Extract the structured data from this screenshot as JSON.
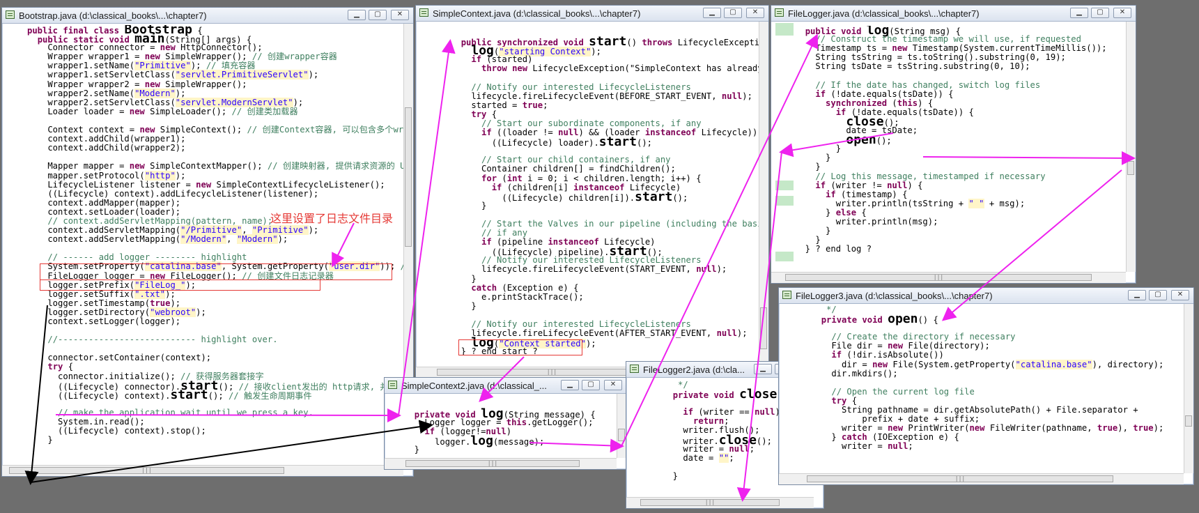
{
  "windows": {
    "bootstrap": {
      "title": "Bootstrap.java (d:\\classical_books\\...\\chapter7)",
      "lines": [
        "public final class Bootstrap {",
        "  public static void main(String[] args) {",
        "    Connector connector = new HttpConnector();",
        "    Wrapper wrapper1 = new SimpleWrapper(); // 创建wrapper容器",
        "    wrapper1.setName(\"Primitive\"); // 填充容器",
        "    wrapper1.setServletClass(\"servlet.PrimitiveServlet\");",
        "    Wrapper wrapper2 = new SimpleWrapper();",
        "    wrapper2.setName(\"Modern\");",
        "    wrapper2.setServletClass(\"servlet.ModernServlet\");",
        "    Loader loader = new SimpleLoader(); // 创建类加载器",
        "",
        "    Context context = new SimpleContext(); // 创建Context容器, 可以包含多个wrappe",
        "    context.addChild(wrapper1);",
        "    context.addChild(wrapper2);",
        "",
        "    Mapper mapper = new SimpleContextMapper(); // 创建映射器, 提供请求资源的 URI",
        "    mapper.setProtocol(\"http\");",
        "    LifecycleListener listener = new SimpleContextLifecycleListener();",
        "    ((Lifecycle) context).addLifecycleListener(listener);",
        "    context.addMapper(mapper);",
        "    context.setLoader(loader);",
        "    // context.addServletMapping(pattern, name);",
        "    context.addServletMapping(\"/Primitive\", \"Primitive\");",
        "    context.addServletMapping(\"/Modern\", \"Modern\");",
        "",
        "    // ------ add logger -------- highlight",
        "    System.setProperty(\"catalina.base\", System.getProperty(\"user.dir\")); //",
        "    FileLogger logger = new FileLogger(); // 创建文件日志记录器",
        "    logger.setPrefix(\"FileLog_\");",
        "    logger.setSuffix(\".txt\");",
        "    logger.setTimestamp(true);",
        "    logger.setDirectory(\"webroot\");",
        "    context.setLogger(logger);",
        "",
        "    //--------------------------- highlight over.",
        "",
        "    connector.setContainer(context);",
        "    try {",
        "      connector.initialize(); // 获得服务器套接字",
        "      ((Lifecycle) connector).start(); // 接收client发出的 http请求, 并做处理。",
        "      ((Lifecycle) context).start(); // 触发生命周期事件",
        "",
        "      // make the application wait until we press a key.",
        "      System.in.read();",
        "      ((Lifecycle) context).stop();",
        "    }"
      ]
    },
    "simplecontext": {
      "title": "SimpleContext.java (d:\\classical_books\\...\\chapter7)",
      "lines": [
        "",
        "  public synchronized void start() throws LifecycleException {",
        "    log(\"starting Context\");",
        "    if (started)",
        "      throw new LifecycleException(\"SimpleContext has already st",
        "",
        "    // Notify our interested LifecycleListeners",
        "    lifecycle.fireLifecycleEvent(BEFORE_START_EVENT, null);",
        "    started = true;",
        "    try {",
        "      // Start our subordinate components, if any",
        "      if ((loader != null) && (loader instanceof Lifecycle))",
        "        ((Lifecycle) loader).start();",
        "",
        "      // Start our child containers, if any",
        "      Container children[] = findChildren();",
        "      for (int i = 0; i < children.length; i++) {",
        "        if (children[i] instanceof Lifecycle)",
        "          ((Lifecycle) children[i]).start();",
        "      }",
        "",
        "      // Start the Valves in our pipeline (including the basic),",
        "      // if any",
        "      if (pipeline instanceof Lifecycle)",
        "        ((Lifecycle) pipeline).start();",
        "      // Notify our interested LifecycleListeners",
        "      lifecycle.fireLifecycleEvent(START_EVENT, null);",
        "    }",
        "    catch (Exception e) {",
        "      e.printStackTrace();",
        "    }",
        "",
        "    // Notify our interested LifecycleListeners",
        "    lifecycle.fireLifecycleEvent(AFTER_START_EVENT, null);",
        "    log(\"Context started\");",
        "  } ? end start ?"
      ]
    },
    "filelogger": {
      "title": "FileLogger.java (d:\\classical_books\\...\\chapter7)",
      "lines": [
        "  public void log(String msg) {",
        "    // Construct the timestamp we will use, if requested",
        "    Timestamp ts = new Timestamp(System.currentTimeMillis());",
        "    String tsString = ts.toString().substring(0, 19);",
        "    String tsDate = tsString.substring(0, 10);",
        "",
        "    // If the date has changed, switch log files",
        "    if (!date.equals(tsDate)) {",
        "      synchronized (this) {",
        "        if (!date.equals(tsDate)) {",
        "          close();",
        "          date = tsDate;",
        "          open();",
        "        }",
        "      }",
        "    }",
        "    // Log this message, timestamped if necessary",
        "    if (writer != null) {",
        "      if (timestamp) {",
        "        writer.println(tsString + \" \" + msg);",
        "      } else {",
        "        writer.println(msg);",
        "      }",
        "    }",
        "  } ? end log ?"
      ]
    },
    "filelogger3": {
      "title": "FileLogger3.java (d:\\classical_books\\...\\chapter7)",
      "lines": [
        "   */",
        "  private void open() {",
        "",
        "    // Create the directory if necessary",
        "    File dir = new File(directory);",
        "    if (!dir.isAbsolute())",
        "      dir = new File(System.getProperty(\"catalina.base\"), directory);",
        "    dir.mkdirs();",
        "",
        "    // Open the current log file",
        "    try {",
        "      String pathname = dir.getAbsolutePath() + File.separator +",
        "          prefix + date + suffix;",
        "      writer = new PrintWriter(new FileWriter(pathname, true), true);",
        "    } catch (IOException e) {",
        "      writer = null;"
      ]
    },
    "simplecontext2": {
      "title": "SimpleContext2.java (d:\\classical_...",
      "lines": [
        "",
        "  private void log(String message) {",
        "    Logger logger = this.getLogger();",
        "    if (logger!=null)",
        "      logger.log(message);",
        "  }"
      ]
    },
    "filelogger2": {
      "title": "FileLogger2.java (d:\\cla...",
      "lines": [
        "   */",
        "  private void close() {",
        "",
        "    if (writer == null)",
        "      return;",
        "    writer.flush();",
        "    writer.close();",
        "    writer = null;",
        "    date = \"\";",
        "",
        "  }"
      ]
    }
  },
  "annotation": "这里设置了日志文件目录",
  "colors": {
    "keyword": "#7f0055",
    "string": "#2a00ff",
    "comment": "#3f7f5f",
    "field": "#0000c0",
    "arrow_magenta": "#ee22ee",
    "box_red": "#e53935"
  }
}
